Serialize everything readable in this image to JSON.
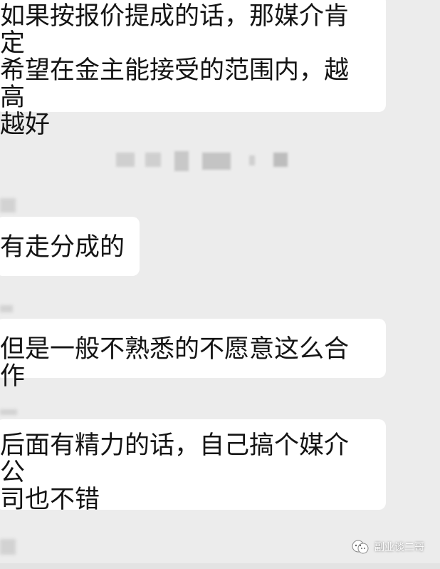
{
  "messages": [
    {
      "lines": [
        "如果按报价提成的话，那媒介肯定",
        "希望在金主能接受的范围内，越高",
        "越好"
      ]
    },
    {
      "lines": [
        "有走分成的"
      ]
    },
    {
      "lines": [
        "但是一般不熟悉的不愿意这么合作"
      ]
    },
    {
      "lines": [
        "后面有精力的话，自己搞个媒介公",
        "司也不错"
      ]
    }
  ],
  "watermark": {
    "text": "副业谈二哥",
    "icon": "wechat-official-account-icon"
  }
}
